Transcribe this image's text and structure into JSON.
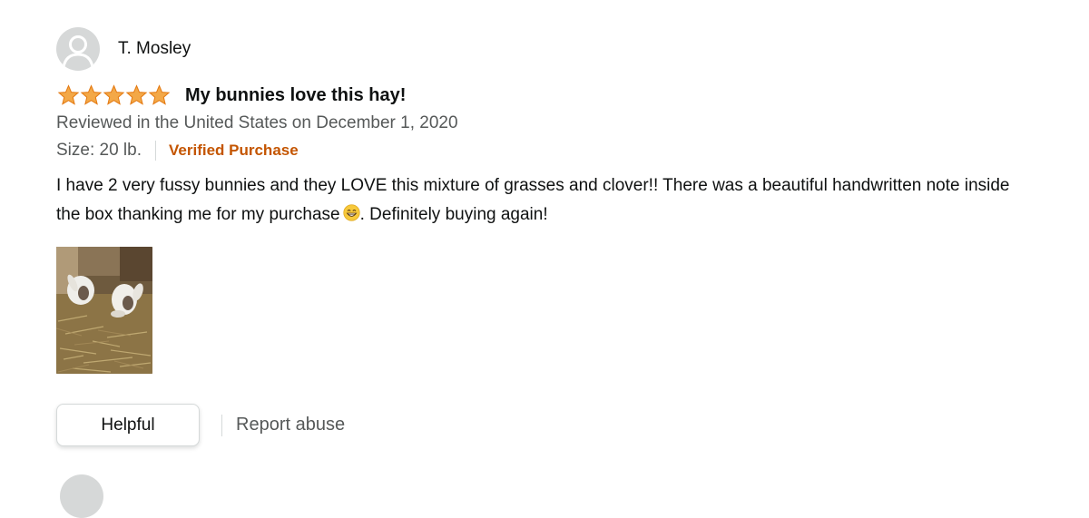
{
  "review": {
    "profile_name": "T. Mosley",
    "avatar_icon": "user-silhouette-icon",
    "rating": 5,
    "max_rating": 5,
    "star_color": "#f3a847",
    "title": "My bunnies love this hay!",
    "date": "Reviewed in the United States on December 1, 2020",
    "size": "Size: 20 lb.",
    "verified": "Verified Purchase",
    "verified_color": "#c45500",
    "body_before_emoji": "I have 2 very fussy bunnies and they LOVE this mixture of grasses and clover!! There was a beautiful handwritten note inside the box thanking me for my purchase",
    "emoji_icon": "grinning-face-emoji-icon",
    "body_after_emoji": ". Definitely buying again!",
    "helpful_label": "Helpful",
    "report_label": "Report abuse"
  }
}
